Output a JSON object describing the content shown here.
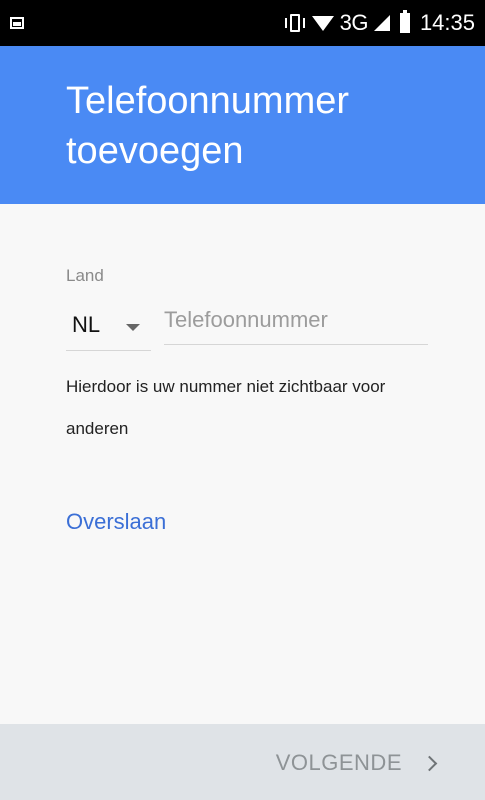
{
  "status_bar": {
    "left_icon": "image-notification-icon",
    "network": "3G",
    "time": "14:35"
  },
  "header": {
    "title": "Telefoonnummer toevoegen",
    "background": "#4a8af4"
  },
  "form": {
    "country_label": "Land",
    "country_code": "NL",
    "phone_placeholder": "Telefoonnummer",
    "phone_value": "",
    "helper_text": "Hierdoor is uw nummer niet zichtbaar voor anderen"
  },
  "actions": {
    "skip_label": "Overslaan",
    "next_label": "VOLGENDE",
    "link_color": "#3b6fd6"
  }
}
